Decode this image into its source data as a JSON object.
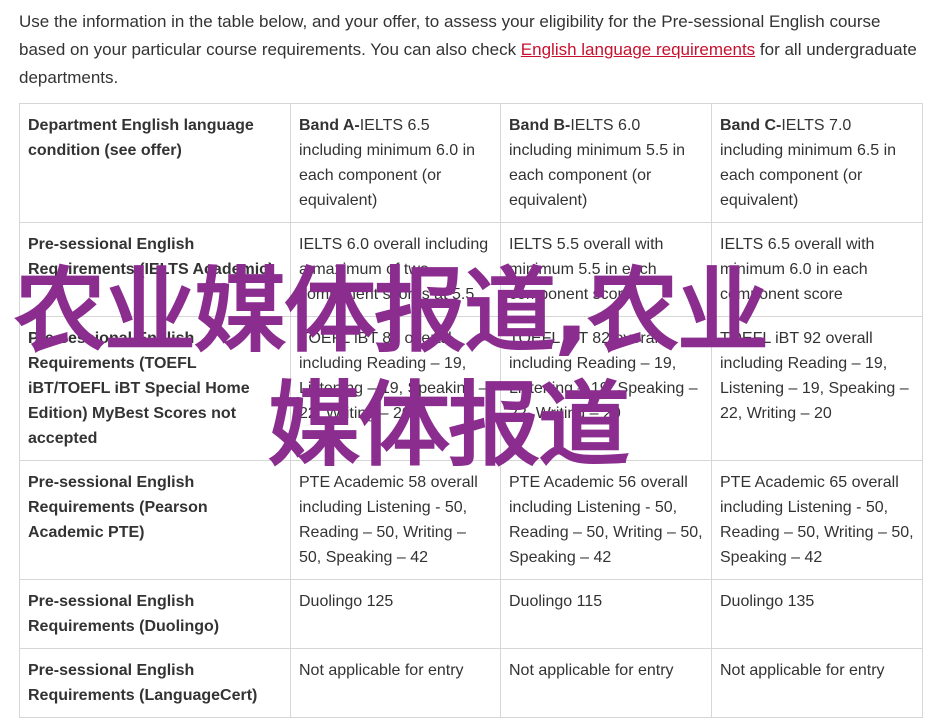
{
  "intro": {
    "text_before": "Use the information in the table below, and your offer, to assess your eligibility for the Pre-sessional English course based on your particular course requirements. You can also check ",
    "link": "English language requirements",
    "text_after": " for all undergraduate departments."
  },
  "table": {
    "header": {
      "label": "Department English language condition (see offer)",
      "bands": [
        {
          "name": "Band A-",
          "text": "IELTS 6.5 including minimum 6.0 in each component (or equivalent)"
        },
        {
          "name": "Band B-",
          "text": "IELTS 6.0 including minimum 5.5 in each component (or equivalent)"
        },
        {
          "name": "Band C-",
          "text": "IELTS 7.0 including minimum 6.5 in each component (or equivalent)"
        }
      ]
    },
    "rows": [
      {
        "label": "Pre-sessional English Requirements (IELTS Academic)",
        "cells": [
          "IELTS 6.0 overall including a maximum of two component scores at 5.5",
          "IELTS 5.5 overall with minimum 5.5 in each component score",
          "IELTS 6.5 overall with minimum 6.0 in each component score"
        ]
      },
      {
        "label": "Pre-sessional English Requirements (TOEFL iBT/TOEFL iBT Special Home Edition) MyBest Scores not accepted",
        "cells": [
          "TOEFL iBT 82 overall including Reading – 19, Listening – 19, Speaking – 22, Writing – 20",
          "TOEFL iBT 82 overall including Reading – 19, Listening – 19, Speaking – 22, Writing – 20",
          "TOEFL iBT 92 overall including Reading – 19, Listening – 19, Speaking – 22, Writing – 20"
        ]
      },
      {
        "label": "Pre-sessional English Requirements (Pearson Academic PTE)",
        "cells": [
          "PTE Academic 58 overall including Listening - 50, Reading – 50, Writing – 50, Speaking – 42",
          "PTE Academic 56 overall including Listening - 50, Reading – 50, Writing – 50, Speaking – 42",
          "PTE Academic 65 overall including Listening - 50, Reading – 50, Writing – 50, Speaking – 42"
        ]
      },
      {
        "label": "Pre-sessional English Requirements (Duolingo)",
        "cells": [
          "Duolingo 125",
          "Duolingo 115",
          "Duolingo 135"
        ]
      },
      {
        "label": "Pre-sessional English Requirements (LanguageCert)",
        "cells": [
          "Not applicable for entry",
          "Not applicable for entry",
          "Not applicable for entry"
        ]
      }
    ]
  },
  "watermark": {
    "line1": "农业媒体报道,农业",
    "line2": "媒体报道"
  },
  "colors": {
    "link": "#c8102e",
    "watermark": "#8b2c8f",
    "border": "#d6d6d6",
    "text": "#333333"
  }
}
